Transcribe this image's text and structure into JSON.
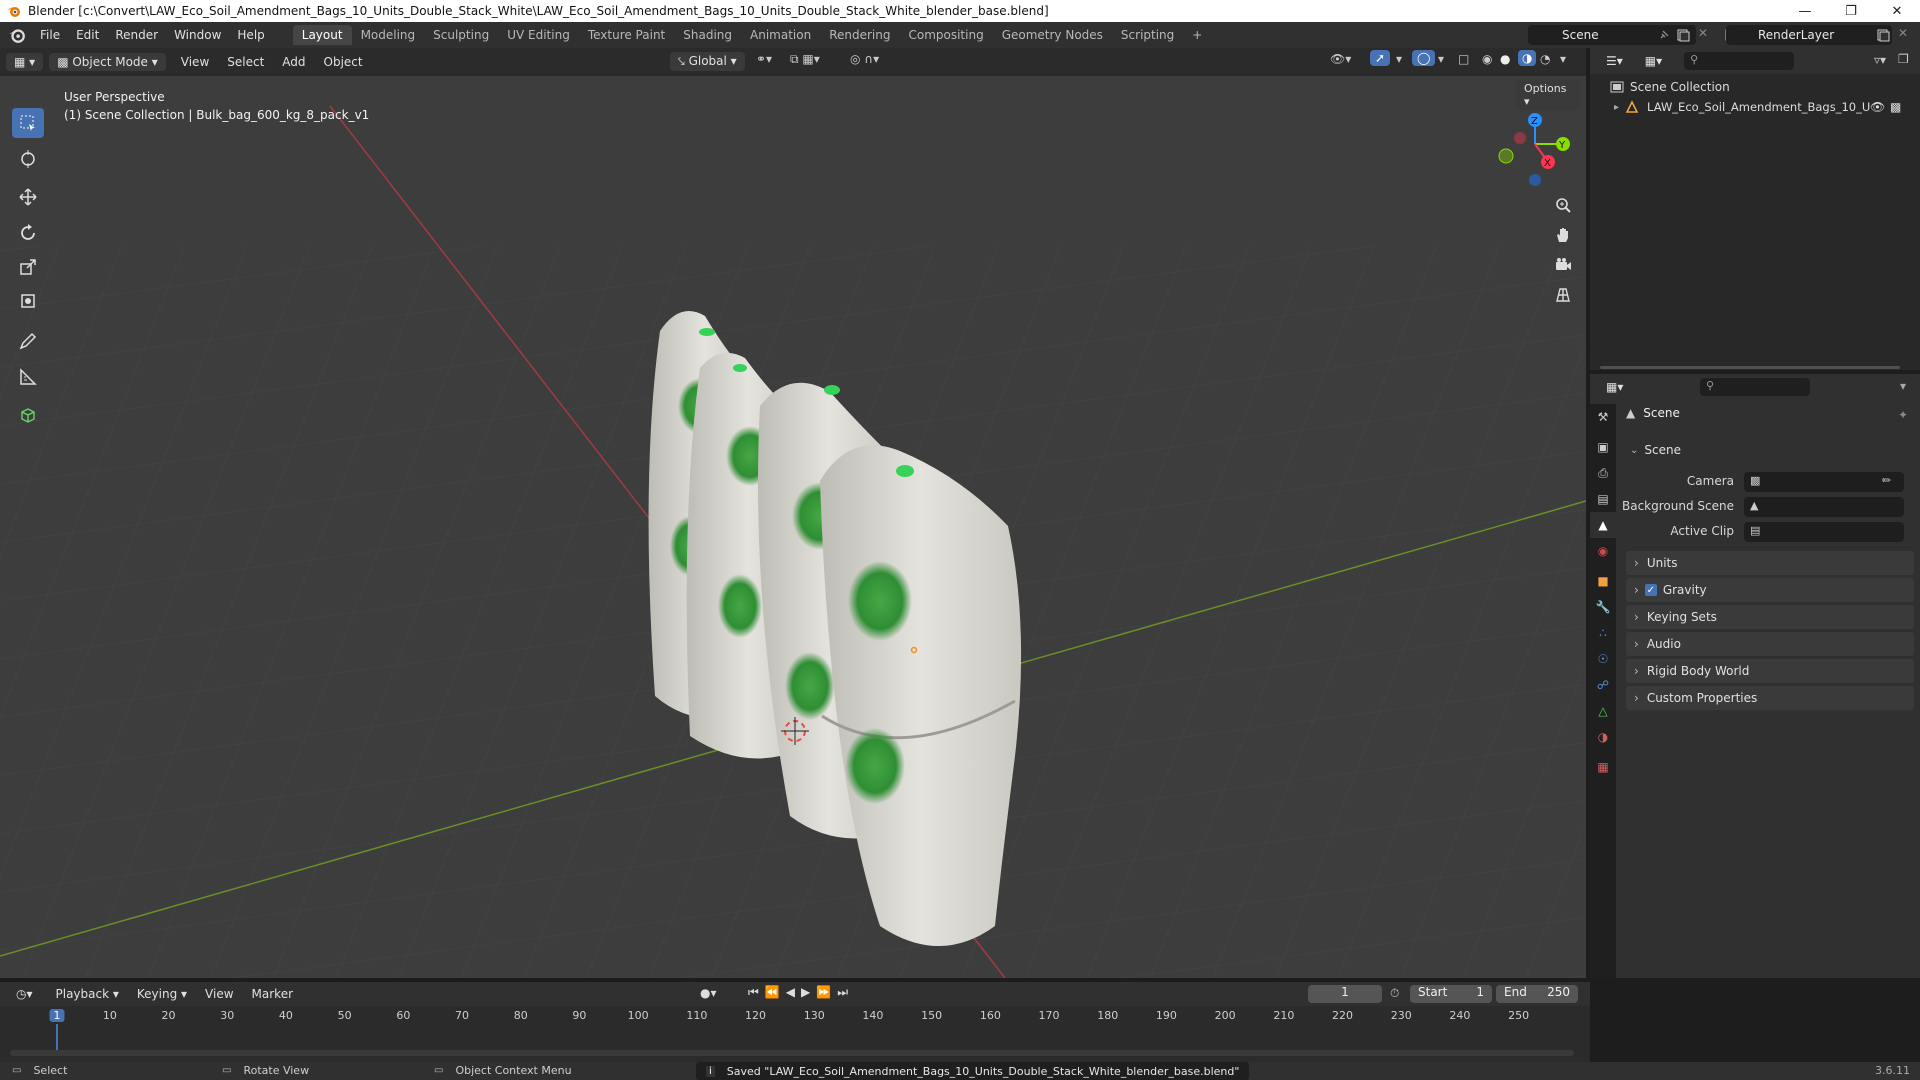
{
  "window": {
    "title": "Blender [c:\\Convert\\LAW_Eco_Soil_Amendment_Bags_10_Units_Double_Stack_White\\LAW_Eco_Soil_Amendment_Bags_10_Units_Double_Stack_White_blender_base.blend]"
  },
  "menu": [
    "File",
    "Edit",
    "Render",
    "Window",
    "Help"
  ],
  "workspaces": [
    "Layout",
    "Modeling",
    "Sculpting",
    "UV Editing",
    "Texture Paint",
    "Shading",
    "Animation",
    "Rendering",
    "Compositing",
    "Geometry Nodes",
    "Scripting"
  ],
  "active_workspace": "Layout",
  "scene_name": "Scene",
  "render_layer": "RenderLayer",
  "viewport_header": {
    "mode": "Object Mode",
    "menus": [
      "View",
      "Select",
      "Add",
      "Object"
    ],
    "orientation": "Global",
    "options": "Options"
  },
  "viewport": {
    "perspective": "User Perspective",
    "collection_info": "(1) Scene Collection | Bulk_bag_600_kg_8_pack_v1"
  },
  "outliner": {
    "root": "Scene Collection",
    "items": [
      "LAW_Eco_Soil_Amendment_Bags_10_U"
    ]
  },
  "properties": {
    "header": "Scene",
    "section": "Scene",
    "fields": {
      "camera_label": "Camera",
      "background_label": "Background Scene",
      "clip_label": "Active Clip"
    },
    "panels": [
      "Units",
      "Gravity",
      "Keying Sets",
      "Audio",
      "Rigid Body World",
      "Custom Properties"
    ],
    "gravity_checked": true
  },
  "timeline": {
    "menus": [
      "Playback",
      "Keying",
      "View",
      "Marker"
    ],
    "current_frame": "1",
    "start_label": "Start",
    "start": "1",
    "end_label": "End",
    "end": "250",
    "ticks": [
      "1",
      "10",
      "20",
      "30",
      "40",
      "50",
      "60",
      "70",
      "80",
      "90",
      "100",
      "110",
      "120",
      "130",
      "140",
      "150",
      "160",
      "170",
      "180",
      "190",
      "200",
      "210",
      "220",
      "230",
      "240",
      "250"
    ]
  },
  "statusbar": {
    "select": "Select",
    "rotate": "Rotate View",
    "context": "Object Context Menu",
    "message": "Saved \"LAW_Eco_Soil_Amendment_Bags_10_Units_Double_Stack_White_blender_base.blend\"",
    "version": "3.6.11"
  },
  "colors": {
    "accent": "#4772b3",
    "x_axis": "#ff3352",
    "y_axis": "#8bdc00",
    "z_axis": "#2890ff"
  }
}
